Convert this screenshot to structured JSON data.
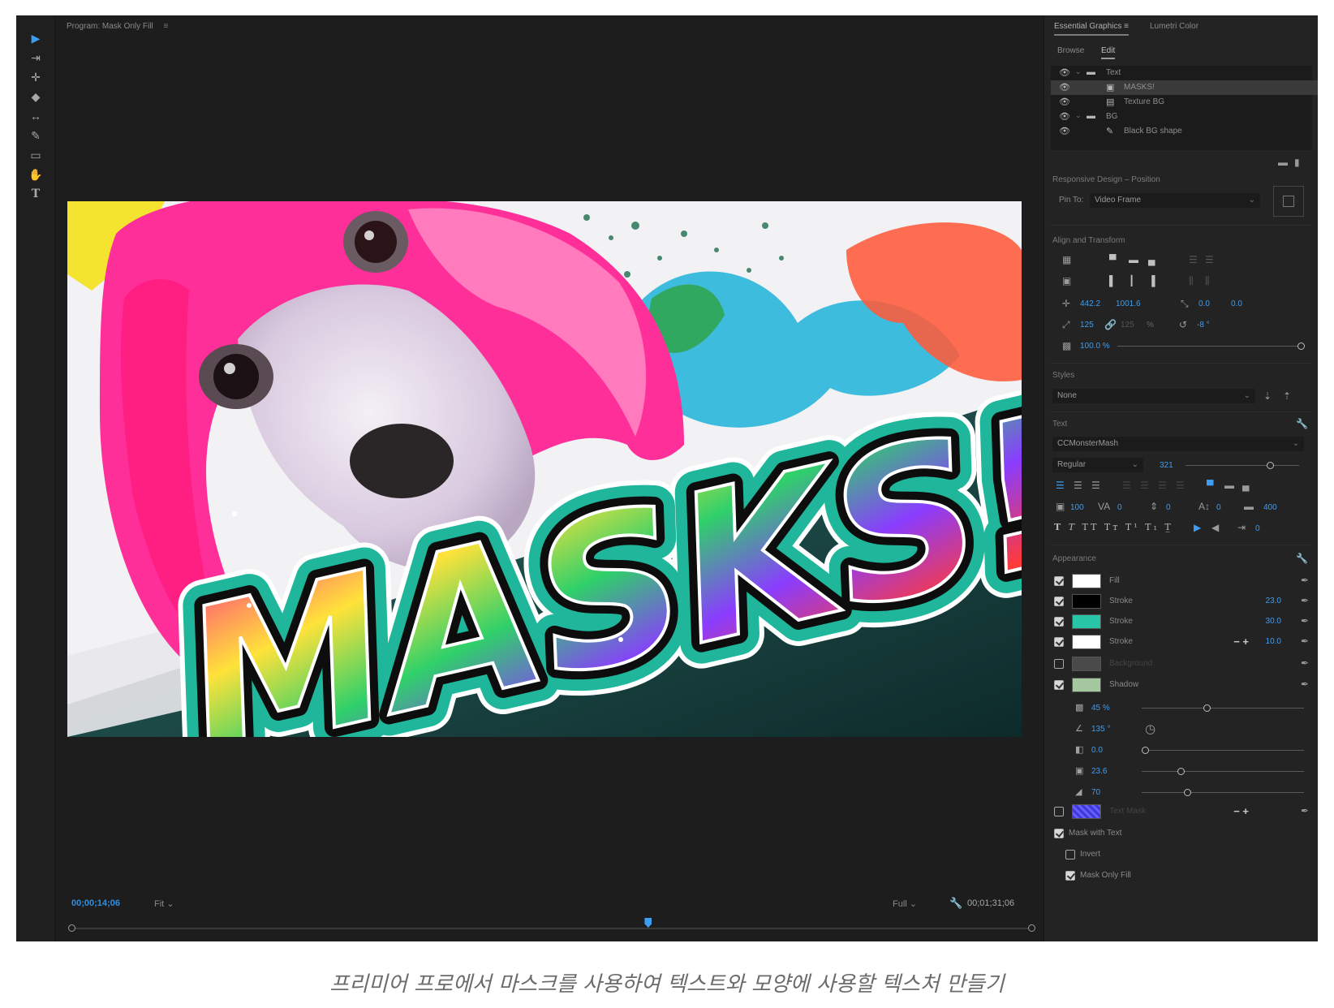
{
  "monitor": {
    "title": "Program: Mask Only Fill",
    "menu_icon": "≡",
    "timecode_current": "00;00;14;06",
    "fit_select": "Fit",
    "resolution_select": "Full",
    "timecode_duration": "00;01;31;06",
    "playhead_position": 0.6
  },
  "artwork": {
    "headline": "MASKS!",
    "colors": {
      "hair": "#ff2f9a",
      "teal": "#1fb69b",
      "splash_blue": "#27b7e3",
      "splash_orange": "#ff6a3d"
    }
  },
  "panel": {
    "tabs": [
      "Essential Graphics",
      "Lumetri Color"
    ],
    "subtabs": [
      "Browse",
      "Edit"
    ],
    "layers": [
      {
        "label": "Text",
        "type": "folder"
      },
      {
        "label": "MASKS!",
        "type": "text",
        "selected": true
      },
      {
        "label": "Texture BG",
        "type": "clip"
      },
      {
        "label": "BG",
        "type": "folder"
      },
      {
        "label": "Black BG shape",
        "type": "shape"
      }
    ],
    "responsive_heading": "Responsive Design – Position",
    "pin_to_label": "Pin To:",
    "pin_to_value": "Video Frame",
    "align_heading": "Align and Transform",
    "transform": {
      "position_x": "442.2",
      "position_y": "1001.6",
      "anchor_x": "0.0",
      "anchor_y": "0.0",
      "scale": "125",
      "scale_linked": "125",
      "rotation": "-8 °",
      "opacity": "100.0 %"
    },
    "styles_heading": "Styles",
    "styles_value": "None",
    "text_heading": "Text",
    "font_name": "CCMonsterMash",
    "font_style": "Regular",
    "font_size": "321",
    "text_values": {
      "kerning": "100",
      "tracking": "0",
      "leading": "0",
      "baseline": "0",
      "tsume": "400",
      "indent": "0"
    },
    "type_buttons": [
      "T",
      "T",
      "TT",
      "Tт",
      "T¹",
      "T₁",
      "T̲"
    ],
    "appearance_heading": "Appearance",
    "appearance": [
      {
        "label": "Fill",
        "color": "#ffffff",
        "checked": true
      },
      {
        "label": "Stroke",
        "color": "#000000",
        "checked": true,
        "value": "23.0"
      },
      {
        "label": "Stroke",
        "color": "#26c6a6",
        "checked": true,
        "value": "30.0"
      },
      {
        "label": "Stroke",
        "color": "#ffffff",
        "checked": true,
        "value": "10.0"
      },
      {
        "label": "Background",
        "color": "#4a4a4a",
        "checked": false
      },
      {
        "label": "Shadow",
        "color": "#a6c8a0",
        "checked": true
      }
    ],
    "shadow": {
      "opacity": "45 %",
      "angle": "135 °",
      "distance": "0.0",
      "size": "23.6",
      "blur": "70"
    },
    "text_mask_label": "Text Mask",
    "mask_with_text": "Mask with Text",
    "invert_label": "Invert",
    "mask_only_fill": "Mask Only Fill"
  },
  "caption": "프리미어 프로에서 마스크를 사용하여 텍스트와 모양에 사용할 텍스처 만들기"
}
